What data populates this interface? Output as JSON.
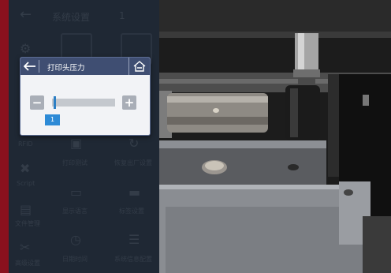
{
  "background": {
    "header": {
      "title": "系统设置",
      "page_number": "1"
    },
    "sidebar": [
      {
        "icon": "gear-icon",
        "label": ""
      },
      {
        "icon": "rfid-text-icon",
        "label": "RFID"
      },
      {
        "icon": "script-tools-icon",
        "label": "Script"
      },
      {
        "icon": "folder-icon",
        "label": "文件管理"
      },
      {
        "icon": "wrench-icon",
        "label": "高级设置"
      }
    ],
    "tiles": [
      {
        "icon": "ribbon-icon",
        "label": ""
      },
      {
        "icon": "paper-icon",
        "label": ""
      },
      {
        "icon": "print-icon",
        "label": "打印测试"
      },
      {
        "icon": "refresh-icon",
        "label": "恢复出厂设置"
      },
      {
        "icon": "comment-icon",
        "label": "显示语言"
      },
      {
        "icon": "ruler-icon",
        "label": "标签设置"
      },
      {
        "icon": "clock-icon",
        "label": "日期时间"
      },
      {
        "icon": "list-icon",
        "label": "系统信息配置"
      }
    ]
  },
  "dialog": {
    "title": "打印头压力",
    "minus": "−",
    "plus": "+",
    "value": "1",
    "fraction": 0.02
  },
  "colors": {
    "accent_red": "#c0182a",
    "dialog_header": "#3f4e72",
    "slider_blue": "#2d7fc4"
  }
}
